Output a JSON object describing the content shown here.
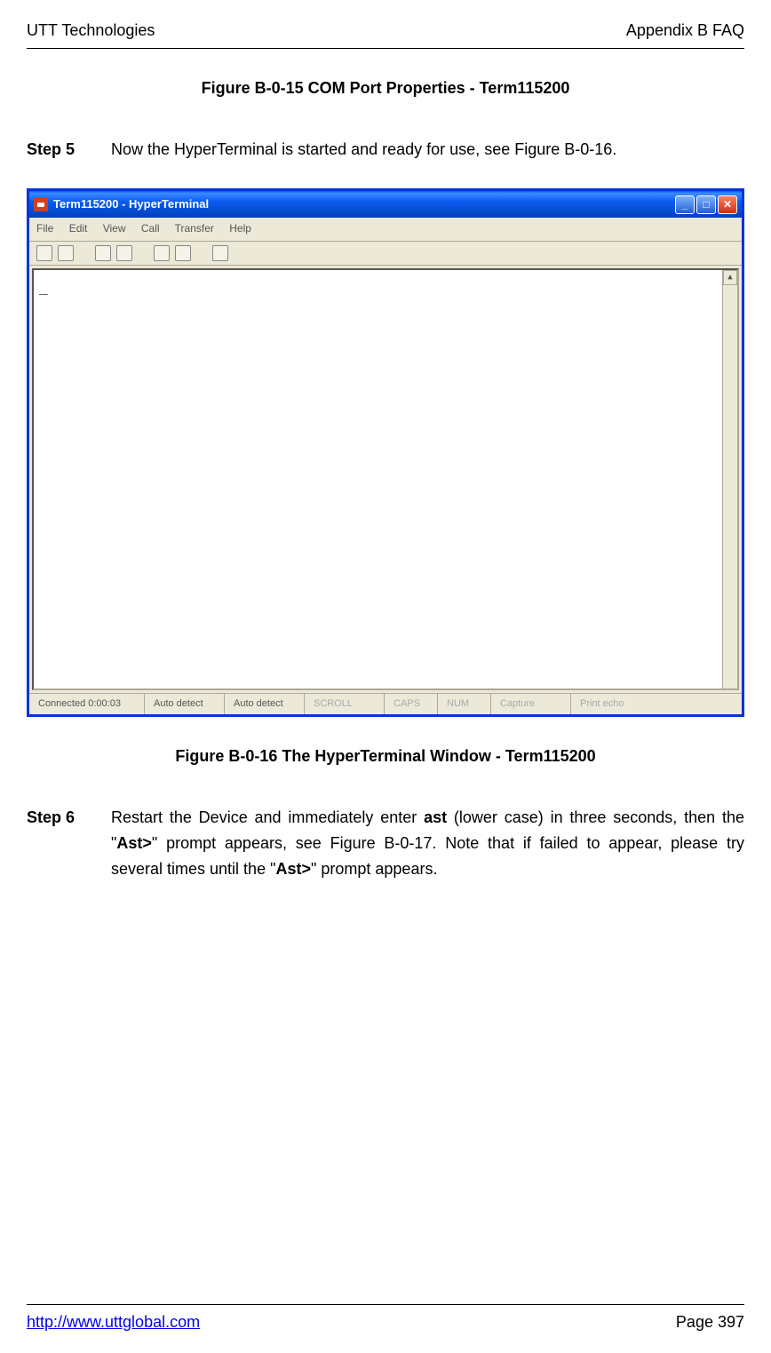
{
  "header": {
    "left": "UTT Technologies",
    "right": "Appendix B FAQ"
  },
  "caption1": "Figure B-0-15 COM Port Properties - Term115200",
  "step5": {
    "label": "Step 5",
    "text": "Now the HyperTerminal is started and ready for use, see Figure B-0-16."
  },
  "window": {
    "title": "Term115200 - HyperTerminal",
    "menu": {
      "file": "File",
      "edit": "Edit",
      "view": "View",
      "call": "Call",
      "transfer": "Transfer",
      "help": "Help"
    },
    "terminal_content": "_",
    "status": {
      "connected": "Connected 0:00:03",
      "detect1": "Auto detect",
      "detect2": "Auto detect",
      "scroll": "SCROLL",
      "caps": "CAPS",
      "num": "NUM",
      "capture": "Capture",
      "print": "Print echo"
    }
  },
  "caption2": "Figure B-0-16 The HyperTerminal Window - Term115200",
  "step6": {
    "label": "Step 6",
    "text_parts": {
      "p1": "Restart the Device and immediately enter ",
      "b1": "ast",
      "p2": " (lower case) in three seconds, then the \"",
      "b2": "Ast>",
      "p3": "\" prompt appears, see Figure B-0-17. Note that if failed to appear, please try several times until the \"",
      "b3": "Ast>",
      "p4": "\" prompt appears."
    }
  },
  "footer": {
    "url": "http://www.uttglobal.com",
    "page": "Page 397"
  }
}
